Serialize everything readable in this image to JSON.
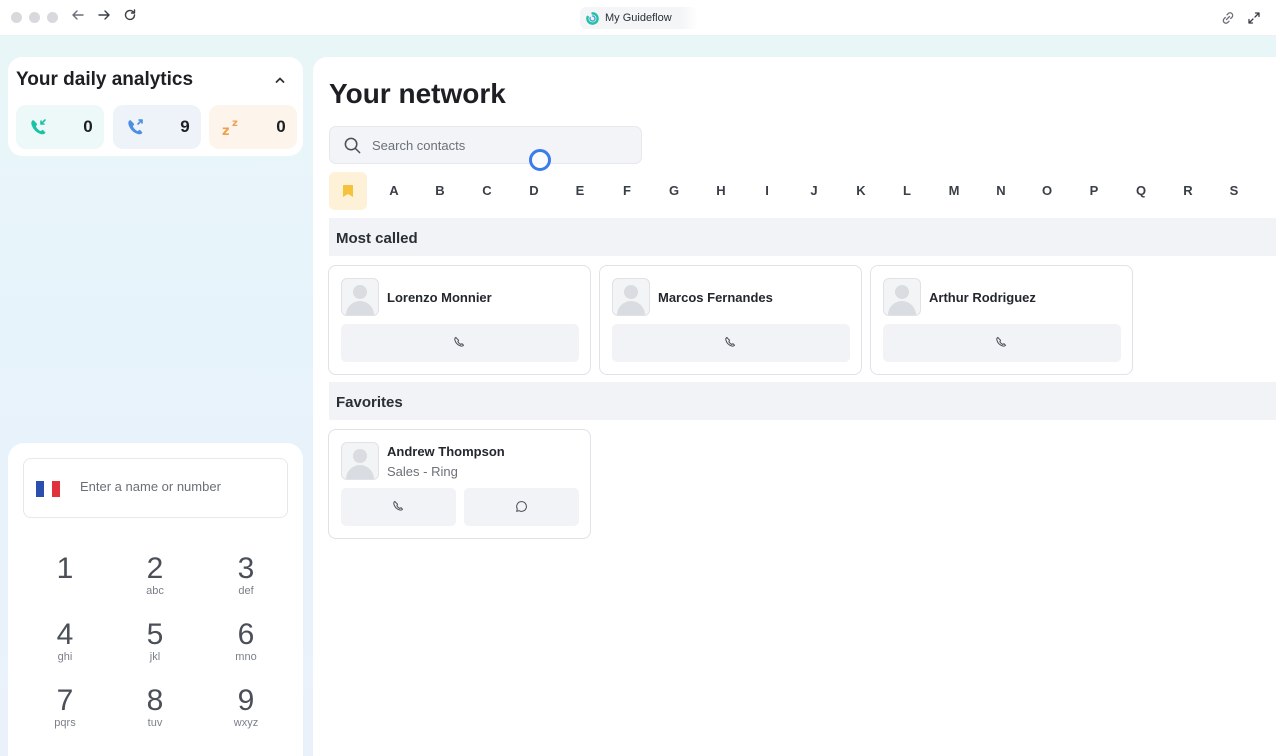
{
  "browser": {
    "tab_title": "My Guideflow",
    "nav_icons": [
      "back-arrow-icon",
      "forward-arrow-icon",
      "reload-icon"
    ],
    "right_icons": [
      "link-icon",
      "expand-icon"
    ]
  },
  "analytics": {
    "title": "Your daily analytics",
    "stats": [
      {
        "icon": "incoming-call-icon",
        "value": "0",
        "color": "#19c3a6",
        "bg": "#edf8f8"
      },
      {
        "icon": "outgoing-call-icon",
        "value": "9",
        "color": "#4a8fe0",
        "bg": "#eef3fa"
      },
      {
        "icon": "snooze-icon",
        "value": "0",
        "color": "#f0a04b",
        "bg": "#fdf5ec"
      }
    ]
  },
  "dialer": {
    "placeholder": "Enter a name or number",
    "flag_colors": [
      "#2b4fae",
      "#ffffff",
      "#e0323c"
    ],
    "keys": [
      {
        "digit": "1",
        "letters": ""
      },
      {
        "digit": "2",
        "letters": "abc"
      },
      {
        "digit": "3",
        "letters": "def"
      },
      {
        "digit": "4",
        "letters": "ghi"
      },
      {
        "digit": "5",
        "letters": "jkl"
      },
      {
        "digit": "6",
        "letters": "mno"
      },
      {
        "digit": "7",
        "letters": "pqrs"
      },
      {
        "digit": "8",
        "letters": "tuv"
      },
      {
        "digit": "9",
        "letters": "wxyz"
      }
    ]
  },
  "network": {
    "title": "Your network",
    "search_placeholder": "Search contacts",
    "letters": [
      "A",
      "B",
      "C",
      "D",
      "E",
      "F",
      "G",
      "H",
      "I",
      "J",
      "K",
      "L",
      "M",
      "N",
      "O",
      "P",
      "Q",
      "R",
      "S"
    ],
    "most_called_label": "Most called",
    "most_called": [
      {
        "name": "Lorenzo Monnier"
      },
      {
        "name": "Marcos Fernandes"
      },
      {
        "name": "Arthur Rodriguez"
      }
    ],
    "favorites_label": "Favorites",
    "favorites": [
      {
        "name": "Andrew Thompson",
        "subtitle": "Sales - Ring"
      }
    ]
  }
}
